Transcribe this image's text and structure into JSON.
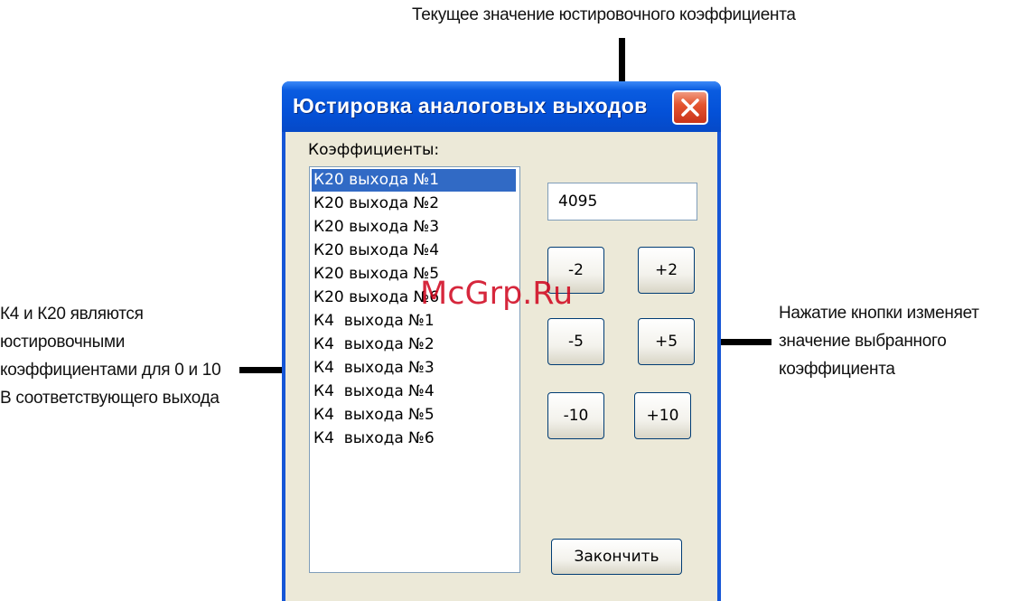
{
  "annotations": {
    "top": "Текущее значение юстировочного коэффициента",
    "left": "К4 и К20 являются юстировочными коэффициентами для 0 и 10 В соответствующего выхода",
    "right": "Нажатие кнопки изменяет значение выбранного коэффициента"
  },
  "window": {
    "title": "Юстировка аналоговых выходов",
    "close_icon": "close-x-icon"
  },
  "coefficients": {
    "label": "Коэффициенты:",
    "items": [
      {
        "label": "К20 выхода №1",
        "selected": true
      },
      {
        "label": "К20 выхода №2",
        "selected": false
      },
      {
        "label": "К20 выхода №3",
        "selected": false
      },
      {
        "label": "К20 выхода №4",
        "selected": false
      },
      {
        "label": "К20 выхода №5",
        "selected": false
      },
      {
        "label": "К20 выхода №6",
        "selected": false
      },
      {
        "label": "К4  выхода №1",
        "selected": false
      },
      {
        "label": "К4  выхода №2",
        "selected": false
      },
      {
        "label": "К4  выхода №3",
        "selected": false
      },
      {
        "label": "К4  выхода №4",
        "selected": false
      },
      {
        "label": "К4  выхода №5",
        "selected": false
      },
      {
        "label": "К4  выхода №6",
        "selected": false
      }
    ]
  },
  "current_value": "4095",
  "buttons": {
    "minus2": "-2",
    "plus2": "+2",
    "minus5": "-5",
    "plus5": "+5",
    "minus10": "-10",
    "plus10": "+10",
    "finish": "Закончить"
  },
  "watermark": "McGrp.Ru",
  "colors": {
    "title_bar": "#0451d8",
    "selection": "#316ac5",
    "close_button": "#e4552f",
    "watermark": "#d0021b"
  }
}
